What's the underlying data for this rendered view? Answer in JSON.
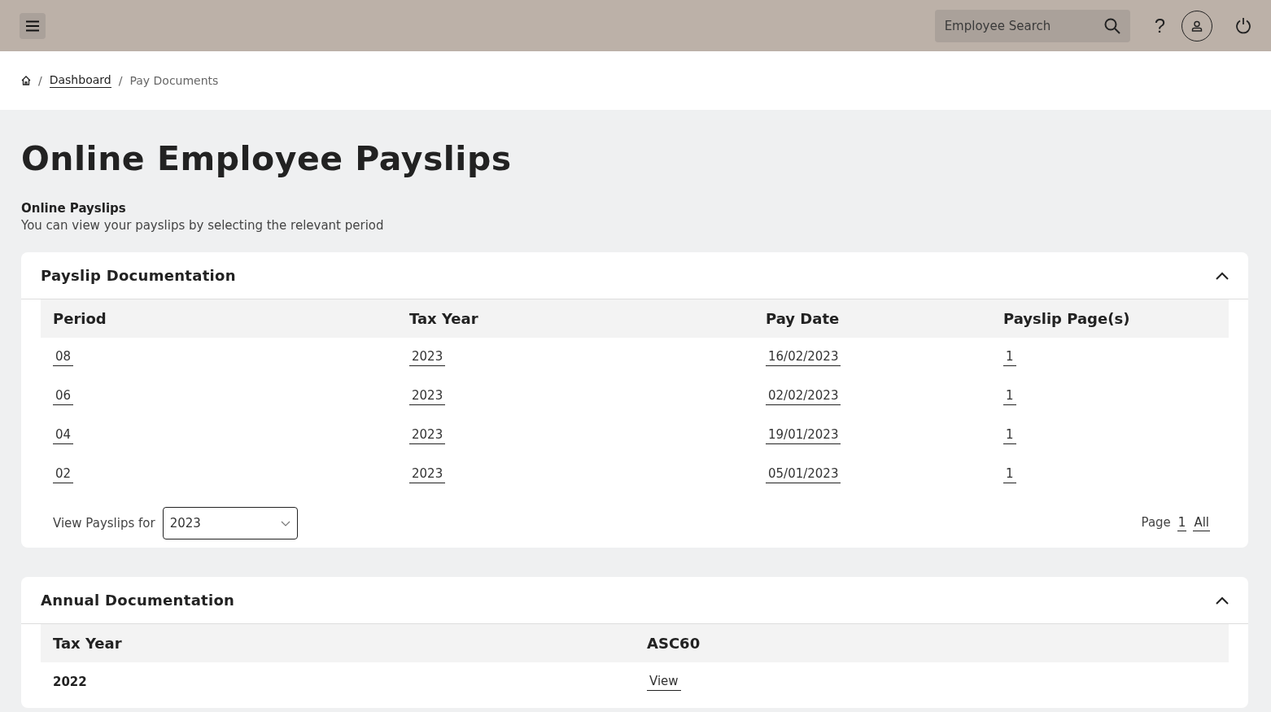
{
  "topbar": {
    "search": {
      "placeholder": "Employee Search"
    },
    "help": "?"
  },
  "breadcrumb": [
    "Dashboard",
    "Pay Documents"
  ],
  "breadcrumb_separator": "/",
  "title": "Online Employee Payslips",
  "intro": {
    "heading": "Online Payslips",
    "text": "You can view your payslips by selecting the relevant period"
  },
  "payslips": {
    "title": "Payslip Documentation",
    "expanded": true,
    "columns": [
      "Period",
      "Tax Year",
      "Pay Date",
      "Payslip Page(s)"
    ],
    "rows": [
      {
        "period": "08",
        "tax_year": "2023",
        "pay_date": "16/02/2023",
        "pages": "1"
      },
      {
        "period": "06",
        "tax_year": "2023",
        "pay_date": "02/02/2023",
        "pages": "1"
      },
      {
        "period": "04",
        "tax_year": "2023",
        "pay_date": "19/01/2023",
        "pages": "1"
      },
      {
        "period": "02",
        "tax_year": "2023",
        "pay_date": "05/01/2023",
        "pages": "1"
      }
    ],
    "filter_label": "View Payslips for",
    "filter_value": "2023",
    "pager": {
      "label": "Page",
      "pages": [
        "1"
      ],
      "all": "All"
    }
  },
  "annual": {
    "title": "Annual Documentation",
    "expanded": true,
    "columns": [
      "Tax Year",
      "ASC60"
    ],
    "rows": [
      {
        "tax_year": "2022",
        "asc60": "View"
      }
    ]
  }
}
